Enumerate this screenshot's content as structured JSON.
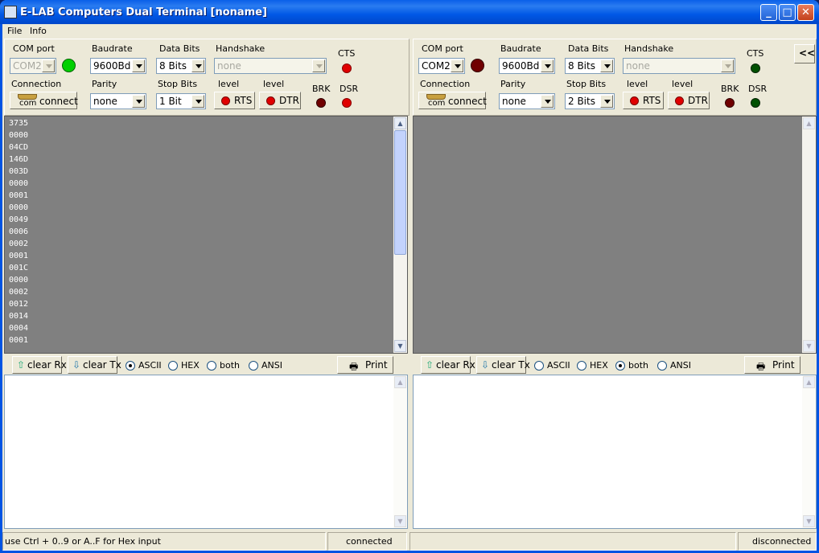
{
  "window": {
    "title": "E-LAB Computers Dual Terminal [noname]"
  },
  "menu": [
    "File",
    "Info"
  ],
  "labels": {
    "com_port": "COM port",
    "baudrate": "Baudrate",
    "data_bits": "Data Bits",
    "handshake": "Handshake",
    "cts": "CTS",
    "connection": "Connection",
    "parity": "Parity",
    "stop_bits": "Stop Bits",
    "level": "level",
    "brk": "BRK",
    "dsr": "DSR",
    "com": "com",
    "connect": "connect",
    "rts": "RTS",
    "dtr": "DTR"
  },
  "left": {
    "com_port": "COM2",
    "baudrate": "9600Bd",
    "data_bits": "8 Bits",
    "handshake": "none",
    "parity": "none",
    "stop_bits": "1 Bit",
    "rx_lines": [
      "3735",
      "0000",
      "04CD",
      "146D",
      "003D",
      "0000",
      "0001",
      "0000",
      "0049",
      "0006",
      "0002",
      "0001",
      "001C",
      "0000",
      "0002",
      "0012",
      "0014",
      "0004",
      "0001"
    ],
    "mode": "ASCII"
  },
  "right": {
    "com_port": "COM2",
    "baudrate": "9600Bd",
    "data_bits": "8 Bits",
    "handshake": "none",
    "parity": "none",
    "stop_bits": "2 Bits",
    "mode": "both"
  },
  "buttons": {
    "collapse": "<<",
    "clear_rx": "clear Rx",
    "clear_tx": "clear Tx",
    "print": "Print"
  },
  "modes": [
    "ASCII",
    "HEX",
    "both",
    "ANSI"
  ],
  "status": {
    "hint": "use Ctrl + 0..9 or A..F for Hex input",
    "left_state": "connected",
    "right_state": "disconnected"
  },
  "colors": {
    "led_green": "#00d000",
    "led_red": "#e00000",
    "led_darkred": "#700000",
    "led_darkgreen": "#005000",
    "rx_bg": "#808080"
  }
}
